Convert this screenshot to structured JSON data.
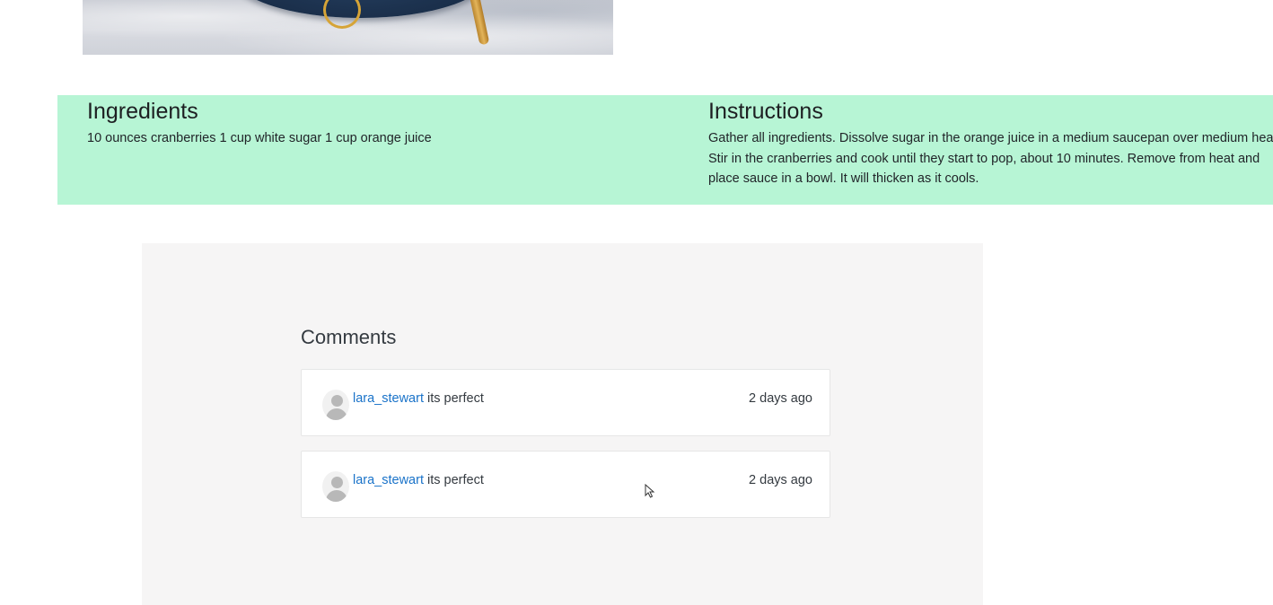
{
  "recipe": {
    "image_alt": "cranberry sauce in a blue bowl with a golden spoon on marble"
  },
  "ingredients": {
    "title": "Ingredients",
    "text": "10 ounces cranberries 1 cup white sugar 1 cup orange juice"
  },
  "instructions": {
    "title": "Instructions",
    "text": "Gather all ingredients. Dissolve sugar in the orange juice in a medium saucepan over medium heat. Stir in the cranberries and cook until they start to pop, about 10 minutes. Remove from heat and place sauce in a bowl. It will thicken as it cools."
  },
  "comments": {
    "title": "Comments",
    "items": [
      {
        "user": "lara_stewart",
        "text": "its perfect",
        "time": "2 days ago"
      },
      {
        "user": "lara_stewart",
        "text": "its perfect",
        "time": "2 days ago"
      }
    ]
  },
  "colors": {
    "band": "#b7f5d5",
    "panel": "#f6f5f5",
    "link": "#1a73c9"
  },
  "icons": {
    "avatar": "user-avatar-icon",
    "cursor": "mouse-pointer-icon"
  }
}
